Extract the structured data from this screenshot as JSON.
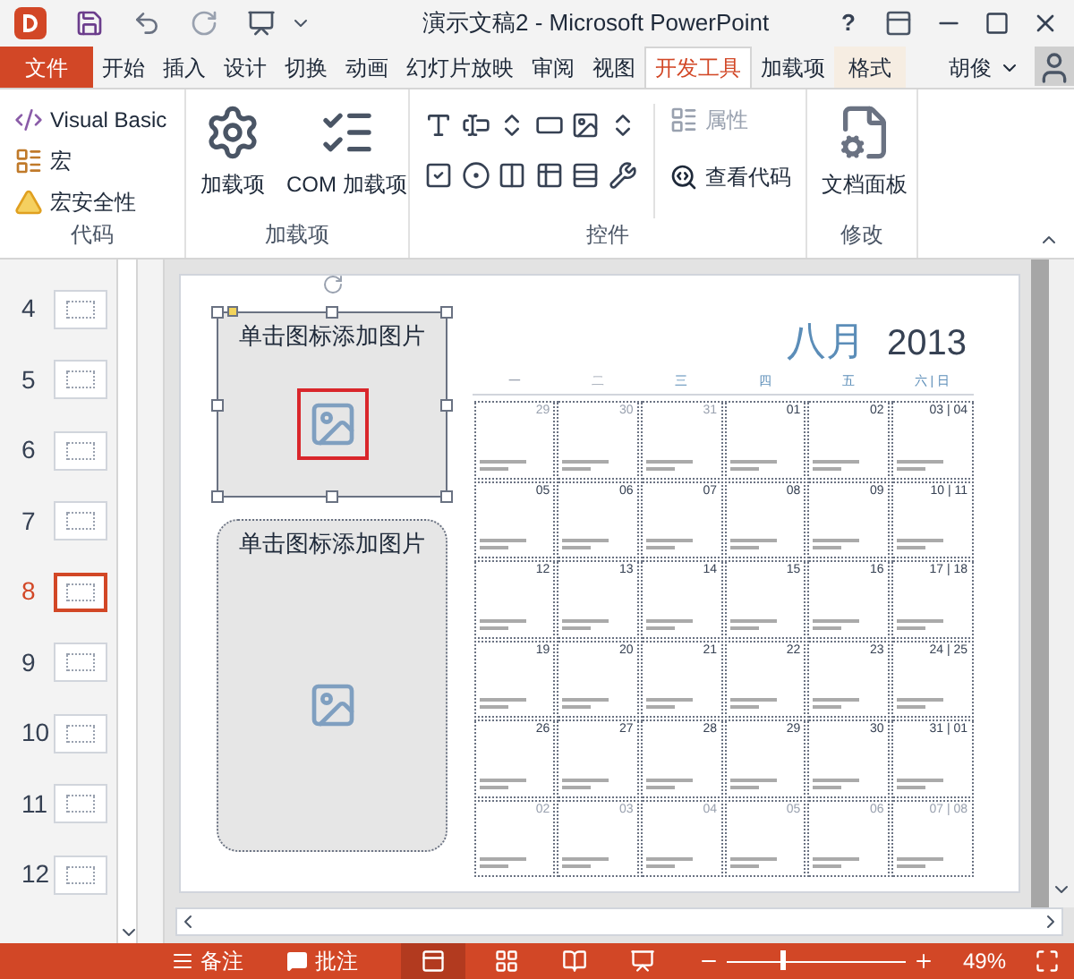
{
  "window": {
    "title": "演示文稿2 - Microsoft PowerPoint",
    "help": "?"
  },
  "tabs": [
    {
      "label": "文件",
      "kind": "file",
      "selected": false
    },
    {
      "label": "开始",
      "kind": "normal",
      "selected": false
    },
    {
      "label": "插入",
      "kind": "normal",
      "selected": false
    },
    {
      "label": "设计",
      "kind": "normal",
      "selected": false
    },
    {
      "label": "切换",
      "kind": "normal",
      "selected": false
    },
    {
      "label": "动画",
      "kind": "normal",
      "selected": false
    },
    {
      "label": "幻灯片放映",
      "kind": "normal",
      "selected": false
    },
    {
      "label": "审阅",
      "kind": "normal",
      "selected": false
    },
    {
      "label": "视图",
      "kind": "normal",
      "selected": false
    },
    {
      "label": "开发工具",
      "kind": "normal",
      "selected": true
    },
    {
      "label": "加载项",
      "kind": "normal",
      "selected": false
    },
    {
      "label": "格式",
      "kind": "contextual",
      "selected": false
    }
  ],
  "user": {
    "name": "胡俊"
  },
  "ribbon": {
    "code": {
      "label": "代码",
      "items": [
        {
          "label": "Visual Basic",
          "kind": "vb"
        },
        {
          "label": "宏",
          "kind": "macro"
        },
        {
          "label": "宏安全性",
          "kind": "warning"
        }
      ]
    },
    "addins": {
      "label": "加载项",
      "buttons": [
        {
          "label": "加载项",
          "kind": "gears"
        },
        {
          "label": "COM 加载项",
          "kind": "list"
        }
      ]
    },
    "controls": {
      "label": "控件",
      "properties": {
        "label": "属性",
        "disabled": true
      },
      "view_code": {
        "label": "查看代码"
      }
    },
    "modify": {
      "label": "修改",
      "button": {
        "label": "文档面板"
      }
    }
  },
  "thumbnails": [
    {
      "number": "4",
      "selected": false
    },
    {
      "number": "5",
      "selected": false
    },
    {
      "number": "6",
      "selected": false
    },
    {
      "number": "7",
      "selected": false
    },
    {
      "number": "8",
      "selected": true
    },
    {
      "number": "9",
      "selected": false
    },
    {
      "number": "10",
      "selected": false
    },
    {
      "number": "11",
      "selected": false
    },
    {
      "number": "12",
      "selected": false
    }
  ],
  "slide": {
    "placeholders": [
      {
        "label": "单击图标添加图片",
        "selected": true
      },
      {
        "label": "单击图标添加图片",
        "selected": false
      }
    ],
    "calendar": {
      "month": "八月",
      "year": "2013",
      "weekdays": [
        "一",
        "二",
        "三",
        "四",
        "五",
        "六 | 日"
      ],
      "weeks": [
        [
          {
            "date": "29",
            "muted": true
          },
          {
            "date": "30",
            "muted": true
          },
          {
            "date": "31",
            "muted": true
          },
          {
            "date": "01",
            "muted": false
          },
          {
            "date": "02",
            "muted": false
          },
          {
            "date": "03 | 04",
            "muted": false
          }
        ],
        [
          {
            "date": "05",
            "muted": false
          },
          {
            "date": "06",
            "muted": false
          },
          {
            "date": "07",
            "muted": false
          },
          {
            "date": "08",
            "muted": false
          },
          {
            "date": "09",
            "muted": false
          },
          {
            "date": "10 | 11",
            "muted": false
          }
        ],
        [
          {
            "date": "12",
            "muted": false
          },
          {
            "date": "13",
            "muted": false
          },
          {
            "date": "14",
            "muted": false
          },
          {
            "date": "15",
            "muted": false
          },
          {
            "date": "16",
            "muted": false
          },
          {
            "date": "17 | 18",
            "muted": false
          }
        ],
        [
          {
            "date": "19",
            "muted": false
          },
          {
            "date": "20",
            "muted": false
          },
          {
            "date": "21",
            "muted": false
          },
          {
            "date": "22",
            "muted": false
          },
          {
            "date": "23",
            "muted": false
          },
          {
            "date": "24 | 25",
            "muted": false
          }
        ],
        [
          {
            "date": "26",
            "muted": false
          },
          {
            "date": "27",
            "muted": false
          },
          {
            "date": "28",
            "muted": false
          },
          {
            "date": "29",
            "muted": false
          },
          {
            "date": "30",
            "muted": false
          },
          {
            "date": "31 | 01",
            "muted": false
          }
        ],
        [
          {
            "date": "02",
            "muted": true
          },
          {
            "date": "03",
            "muted": true
          },
          {
            "date": "04",
            "muted": true
          },
          {
            "date": "05",
            "muted": true
          },
          {
            "date": "06",
            "muted": true
          },
          {
            "date": "07 | 08",
            "muted": true
          }
        ]
      ]
    }
  },
  "status_bar": {
    "notes": "备注",
    "comments": "批注",
    "zoom": {
      "level": 0.3
    },
    "zoom_text": "49%"
  }
}
